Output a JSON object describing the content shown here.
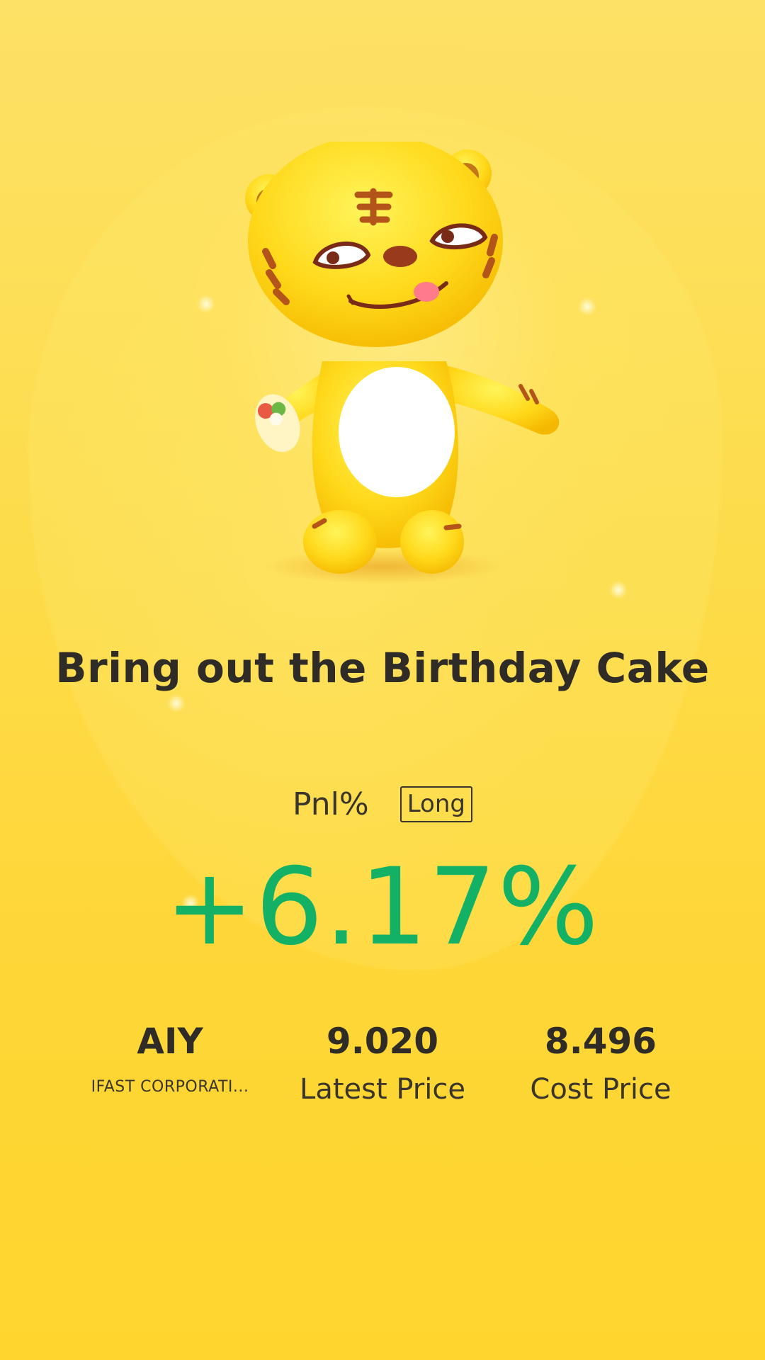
{
  "headline": "Bring out the Birthday Cake",
  "pnl": {
    "label": "Pnl%",
    "direction": "Long",
    "value": "+6.17%",
    "color": "#12b166"
  },
  "stats": {
    "symbol": "AIY",
    "company_name": "IFAST CORPORATI...",
    "latest_price": "9.020",
    "latest_price_label": "Latest Price",
    "cost_price": "8.496",
    "cost_price_label": "Cost Price"
  },
  "illustration": {
    "icon": "tiger-mascot-icon"
  },
  "colors": {
    "background": "#fddd4e",
    "text": "#2f2c27",
    "profit": "#12b166"
  }
}
